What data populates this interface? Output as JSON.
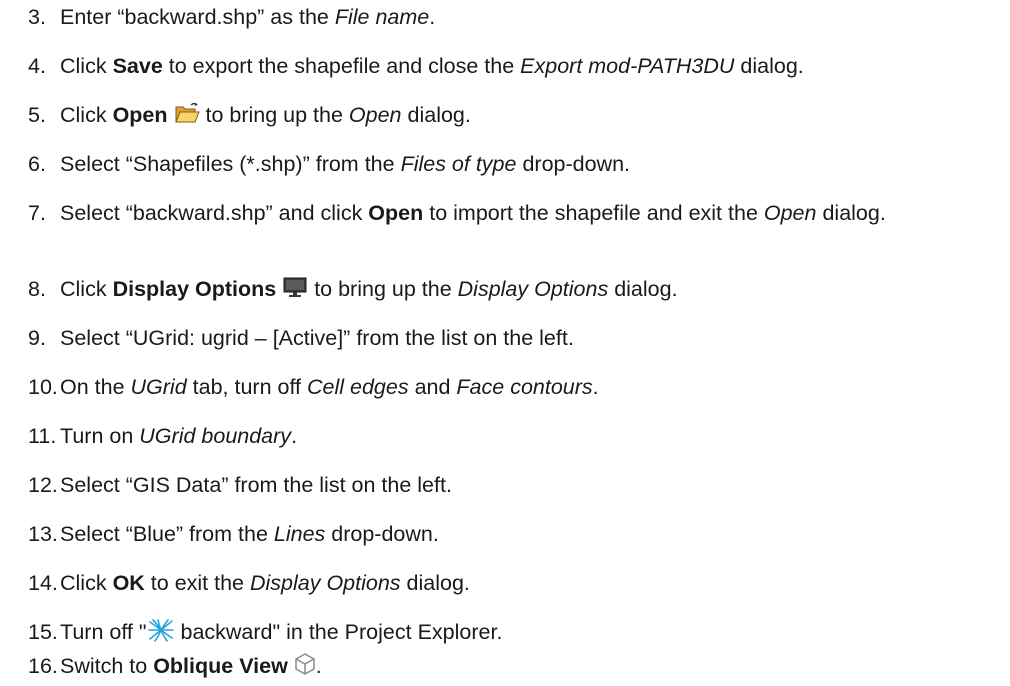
{
  "steps": [
    {
      "num": "3.",
      "parts": [
        {
          "t": "Enter “backward.shp” as the "
        },
        {
          "t": "File name",
          "s": "i"
        },
        {
          "t": "."
        }
      ]
    },
    {
      "num": "4.",
      "parts": [
        {
          "t": "Click "
        },
        {
          "t": "Save",
          "s": "b"
        },
        {
          "t": " to export the shapefile and close the "
        },
        {
          "t": "Export mod-PATH3DU",
          "s": "i"
        },
        {
          "t": " dialog."
        }
      ]
    },
    {
      "num": "5.",
      "parts": [
        {
          "t": "Click "
        },
        {
          "t": "Open",
          "s": "b"
        },
        {
          "t": " "
        },
        {
          "icon": "open-folder-icon"
        },
        {
          "t": " to bring up the "
        },
        {
          "t": "Open",
          "s": "i"
        },
        {
          "t": " dialog."
        }
      ]
    },
    {
      "num": "6.",
      "parts": [
        {
          "t": "Select “Shapefiles (*.shp)” from the "
        },
        {
          "t": "Files of type",
          "s": "i"
        },
        {
          "t": " drop-down."
        }
      ]
    },
    {
      "num": "7.",
      "parts": [
        {
          "t": "Select “backward.shp” and click "
        },
        {
          "t": "Open",
          "s": "b"
        },
        {
          "t": " to import the shapefile and exit the "
        },
        {
          "t": "Open",
          "s": "i"
        },
        {
          "t": " dialog."
        }
      ]
    },
    {
      "num": "8.",
      "parts": [
        {
          "t": "Click "
        },
        {
          "t": "Display Options",
          "s": "b"
        },
        {
          "t": " "
        },
        {
          "icon": "display-options-icon"
        },
        {
          "t": " to bring up the "
        },
        {
          "t": "Display Options",
          "s": "i"
        },
        {
          "t": " dialog."
        }
      ]
    },
    {
      "num": "9.",
      "parts": [
        {
          "t": "Select “UGrid: ugrid – [Active]” from the list on the left."
        }
      ]
    },
    {
      "num": "10.",
      "parts": [
        {
          "t": "On the "
        },
        {
          "t": "UGrid",
          "s": "i"
        },
        {
          "t": " tab, turn off "
        },
        {
          "t": "Cell edges",
          "s": "i"
        },
        {
          "t": " and "
        },
        {
          "t": "Face contours",
          "s": "i"
        },
        {
          "t": "."
        }
      ]
    },
    {
      "num": "11.",
      "parts": [
        {
          "t": "Turn on "
        },
        {
          "t": "UGrid boundary",
          "s": "i"
        },
        {
          "t": "."
        }
      ]
    },
    {
      "num": "12.",
      "parts": [
        {
          "t": "Select “GIS Data” from the list on the left."
        }
      ]
    },
    {
      "num": "13.",
      "parts": [
        {
          "t": "Select “Blue” from the "
        },
        {
          "t": "Lines",
          "s": "i"
        },
        {
          "t": " drop-down."
        }
      ]
    },
    {
      "num": "14.",
      "parts": [
        {
          "t": "Click "
        },
        {
          "t": "OK",
          "s": "b"
        },
        {
          "t": " to exit the "
        },
        {
          "t": "Display Options",
          "s": "i"
        },
        {
          "t": " dialog."
        }
      ]
    },
    {
      "num": "15.",
      "parts": [
        {
          "t": "Turn off \""
        },
        {
          "icon": "pathlines-icon"
        },
        {
          "t": " backward\" in the Project Explorer."
        }
      ]
    },
    {
      "num": "16.",
      "parts": [
        {
          "t": "Switch to "
        },
        {
          "t": "Oblique View",
          "s": "b"
        },
        {
          "t": " "
        },
        {
          "icon": "oblique-view-icon"
        },
        {
          "t": "."
        }
      ]
    }
  ]
}
